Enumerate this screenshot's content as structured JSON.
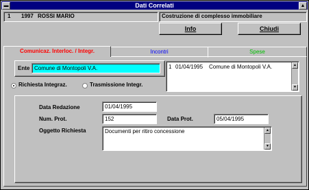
{
  "window": {
    "title": "Dati Correlati"
  },
  "header": {
    "id": "1",
    "year": "1997",
    "name": "ROSSI MARIO",
    "description": "Costruzione di complesso immobiliare"
  },
  "buttons": {
    "info": "Info",
    "close": "Chiudi"
  },
  "tabs": [
    {
      "label": "Comunicaz. Interloc. / Integr.",
      "color": "#ff0000"
    },
    {
      "label": "Incontri",
      "color": "#0000ff"
    },
    {
      "label": "Spese",
      "color": "#00c000"
    }
  ],
  "ente": {
    "label": "Ente",
    "value": "Comune di Montopoli V.A.",
    "highlight": "#00ffff"
  },
  "ente_list": {
    "number": "1",
    "date": "01/04/1995",
    "name": "Comune di Montopoli V.A."
  },
  "radio": {
    "option1": "Richiesta Integraz.",
    "option2": "Trasmissione Integr.",
    "selected": "option1"
  },
  "form": {
    "data_redazione_label": "Data Redazione",
    "data_redazione": "01/04/1995",
    "num_prot_label": "Num. Prot.",
    "num_prot": "152",
    "data_prot_label": "Data Prot.",
    "data_prot": "05/04/1995",
    "oggetto_label": "Oggetto Richiesta",
    "oggetto": "Documenti per ritiro concessione"
  }
}
